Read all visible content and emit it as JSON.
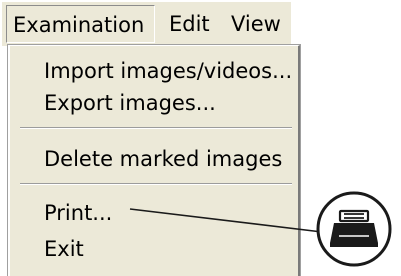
{
  "menubar": {
    "items": [
      {
        "label": "Examination"
      },
      {
        "label": "Edit"
      },
      {
        "label": "View"
      }
    ]
  },
  "examination_menu": {
    "items": [
      {
        "label": "Import images/videos..."
      },
      {
        "label": "Export images..."
      },
      {
        "label": "Delete marked images"
      },
      {
        "label": "Print..."
      },
      {
        "label": "Exit"
      }
    ]
  },
  "callout": {
    "icon": "printer-icon",
    "colors": {
      "stroke": "#1a1a1a",
      "fill": "#ffffff"
    }
  },
  "colors": {
    "menu_background": "#ece9d8"
  }
}
